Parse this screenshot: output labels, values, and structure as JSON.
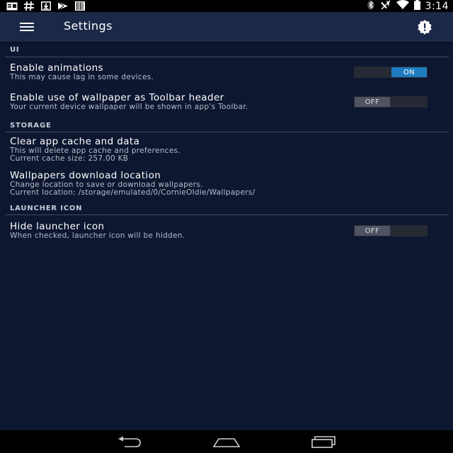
{
  "status_bar": {
    "left_icons": [
      "notification-card-icon",
      "hash-icon",
      "download-icon",
      "play-store-icon",
      "barcode-icon"
    ],
    "right_icons": [
      "bluetooth-icon",
      "mute-icon",
      "wifi-icon",
      "battery-icon"
    ],
    "time": "3:14"
  },
  "toolbar": {
    "title": "Settings",
    "menu_icon": "hamburger-menu-icon",
    "action_icon": "alert-badge-icon"
  },
  "categories": [
    {
      "header": "UI",
      "prefs": [
        {
          "title": "Enable animations",
          "summary": [
            "This may cause lag in some devices."
          ],
          "toggle": "ON",
          "checked": true
        },
        {
          "title": "Enable use of wallpaper as Toolbar header",
          "summary": [
            "Your current device wallpaper will be shown in app's Toolbar."
          ],
          "toggle": "OFF",
          "checked": false
        }
      ]
    },
    {
      "header": "STORAGE",
      "prefs": [
        {
          "title": "Clear app cache and data",
          "summary": [
            "This will delete app cache and preferences.",
            "Current cache size: 257.00 KB"
          ]
        },
        {
          "title": "Wallpapers download location",
          "summary": [
            "Change location to save or download wallpapers.",
            "Current location: /storage/emulated/0/CornieOldie/Wallpapers/"
          ]
        }
      ]
    },
    {
      "header": "LAUNCHER ICON",
      "prefs": [
        {
          "title": "Hide launcher icon",
          "summary": [
            "When checked, launcher icon will be hidden."
          ],
          "toggle": "OFF",
          "checked": false
        }
      ]
    }
  ],
  "nav_bar": {
    "icons": [
      "back-icon",
      "home-icon",
      "recents-icon"
    ]
  },
  "colors": {
    "background": "#0d1730",
    "toolbar": "#1b2848",
    "accent_on": "#1f7bbf",
    "toggle_off": "#4f5361"
  }
}
